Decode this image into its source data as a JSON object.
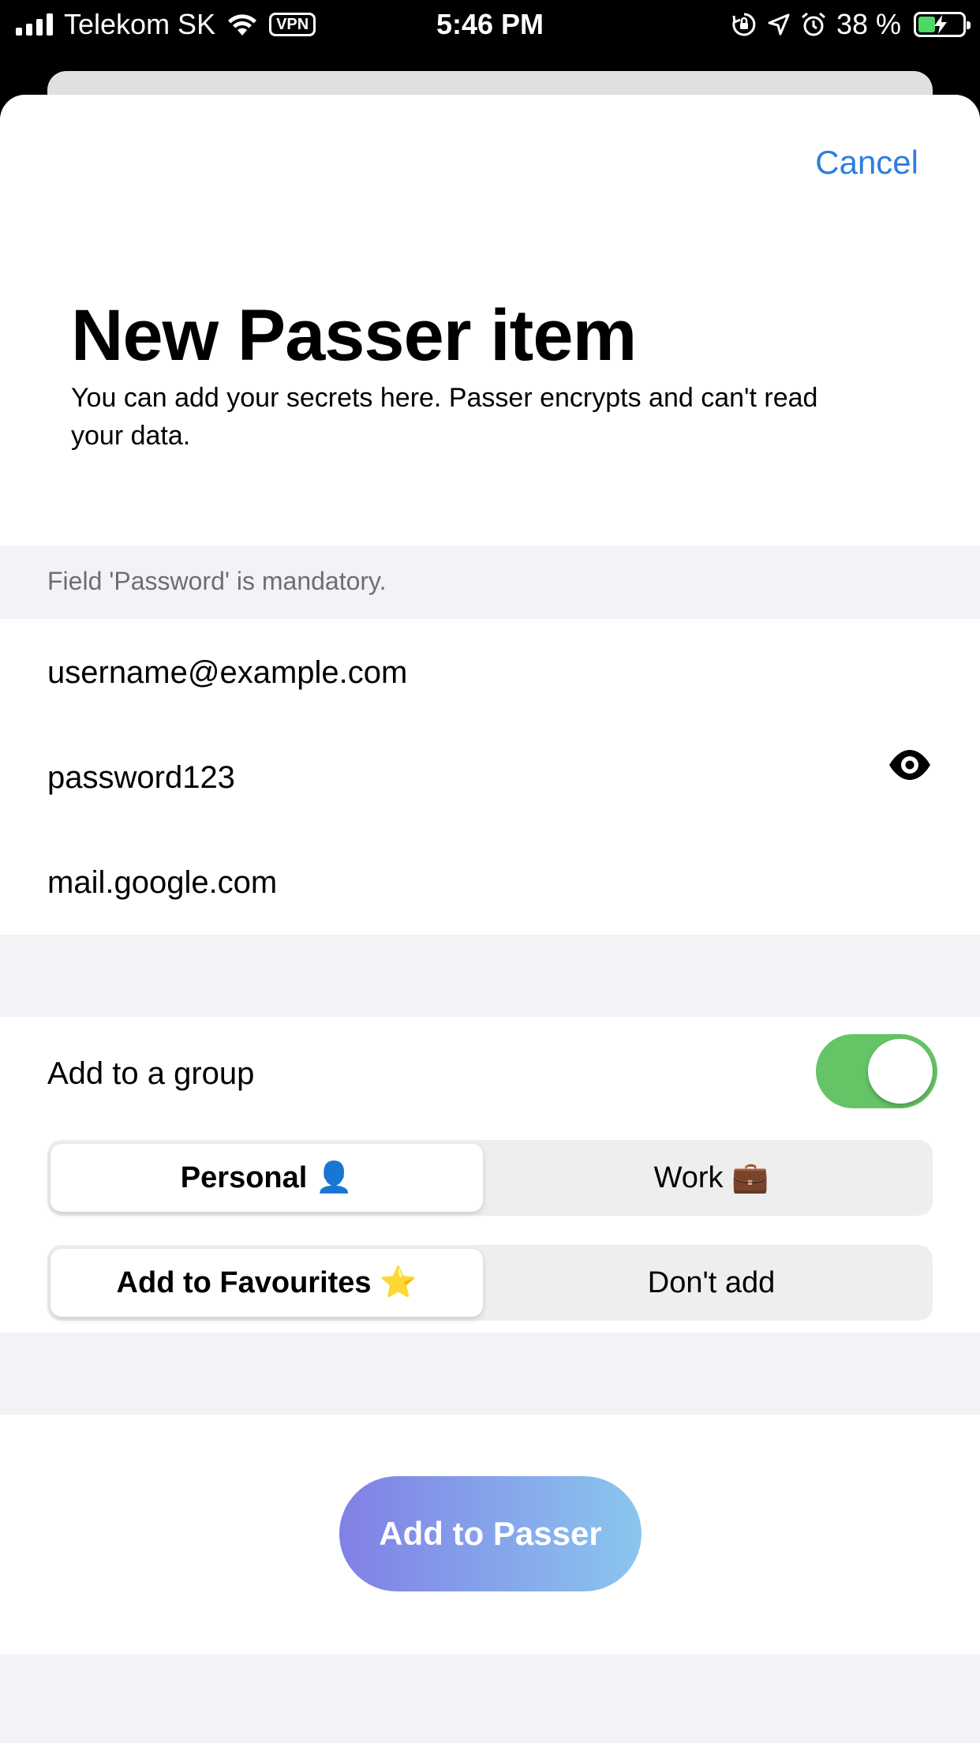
{
  "status_bar": {
    "carrier": "Telekom SK",
    "vpn": "VPN",
    "time": "5:46 PM",
    "battery": "38 %",
    "battery_level": 0.38,
    "battery_color": "#4cd964"
  },
  "sheet": {
    "cancel_label": "Cancel",
    "title": "New Passer item",
    "subtitle": "You can add your secrets here. Passer encrypts and can't read your data.",
    "notice": "Field 'Password' is mandatory."
  },
  "fields": {
    "username": "username@example.com",
    "password": "password123",
    "website": "mail.google.com",
    "password_toggle_icon": "eye-icon"
  },
  "group": {
    "label": "Add to a group",
    "toggle_on": true,
    "toggle_color": "#65c466",
    "options": [
      {
        "label": "Personal 👤",
        "selected": true
      },
      {
        "label": "Work 💼",
        "selected": false
      }
    ]
  },
  "favourites": {
    "options": [
      {
        "label": "Add to Favourites ⭐️",
        "selected": true
      },
      {
        "label": "Don't add",
        "selected": false
      }
    ]
  },
  "primary_button": {
    "label": "Add to Passer",
    "gradient": [
      "#8180e6",
      "#8ac6ee"
    ]
  },
  "accent_color": "#2f7de1"
}
